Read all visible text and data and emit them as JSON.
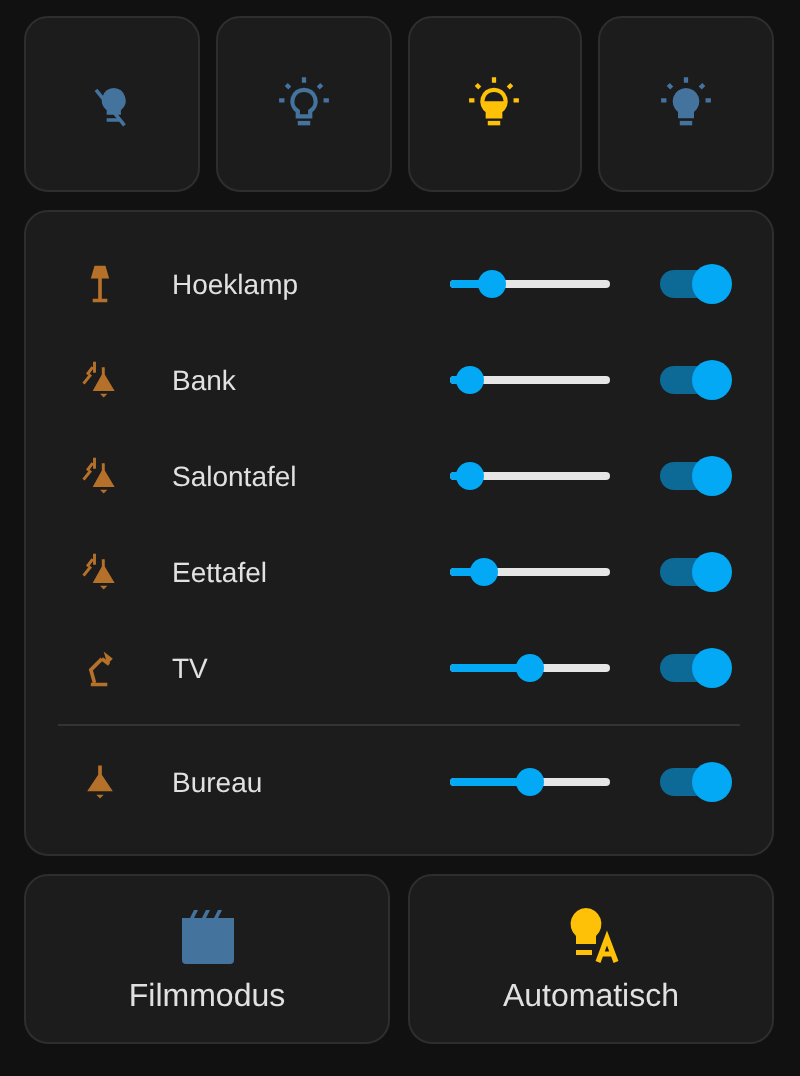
{
  "modes": [
    {
      "kind": "off",
      "selected": false
    },
    {
      "kind": "dim",
      "selected": false
    },
    {
      "kind": "half",
      "selected": true
    },
    {
      "kind": "full",
      "selected": false
    }
  ],
  "light_groups": [
    [
      {
        "kind": "floor-lamp",
        "name": "Hoeklamp",
        "level": 0.26,
        "on": true
      },
      {
        "kind": "ceiling-double",
        "name": "Bank",
        "level": 0.12,
        "on": true
      },
      {
        "kind": "ceiling-double",
        "name": "Salontafel",
        "level": 0.12,
        "on": true
      },
      {
        "kind": "ceiling-double",
        "name": "Eettafel",
        "level": 0.21,
        "on": true
      },
      {
        "kind": "desk-lamp",
        "name": "TV",
        "level": 0.5,
        "on": true
      }
    ],
    [
      {
        "kind": "ceiling",
        "name": "Bureau",
        "level": 0.5,
        "on": true
      }
    ]
  ],
  "scenes": [
    {
      "kind": "film",
      "label": "Filmmodus",
      "on": false
    },
    {
      "kind": "auto",
      "label": "Automatisch",
      "on": true
    }
  ]
}
